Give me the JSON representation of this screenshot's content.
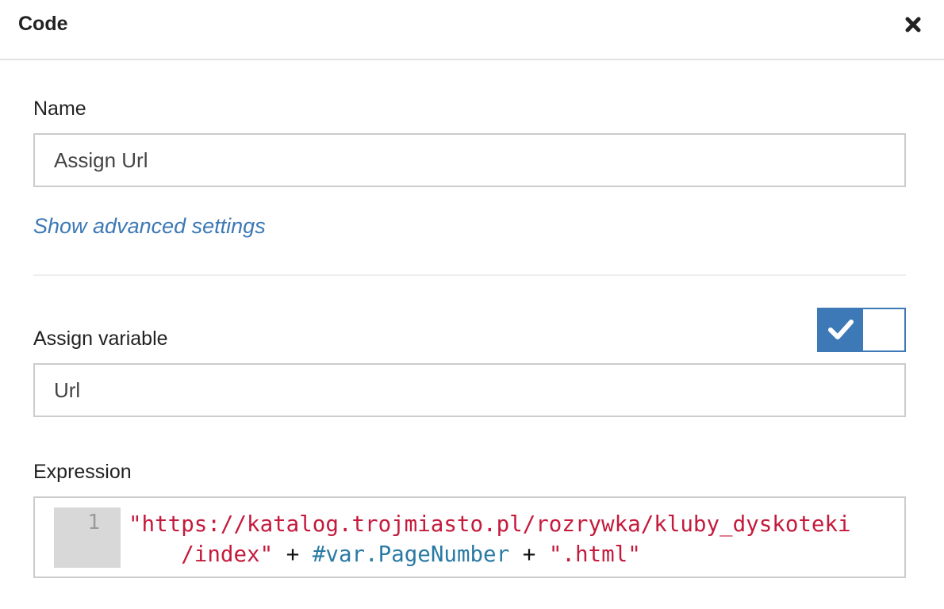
{
  "header": {
    "title": "Code"
  },
  "name_field": {
    "label": "Name",
    "value": "Assign Url"
  },
  "advanced_link": {
    "label": "Show advanced settings"
  },
  "assign_variable": {
    "label": "Assign variable",
    "enabled": true,
    "value": "Url"
  },
  "expression": {
    "label": "Expression",
    "line_number": "1",
    "tokens": {
      "string1_line1": "\"https://katalog.trojmiasto.pl/rozrywka/kluby_dyskoteki",
      "string1_line2": "/index\"",
      "op1": "+",
      "var": "#var.PageNumber",
      "op2": "+",
      "string2": "\".html\""
    }
  },
  "colors": {
    "accent": "#3d79b6",
    "string": "#c41a3c",
    "variable": "#2a7aa4",
    "border": "#cccccc"
  },
  "icons": {
    "close": "close-icon",
    "toggle": "check-icon"
  }
}
